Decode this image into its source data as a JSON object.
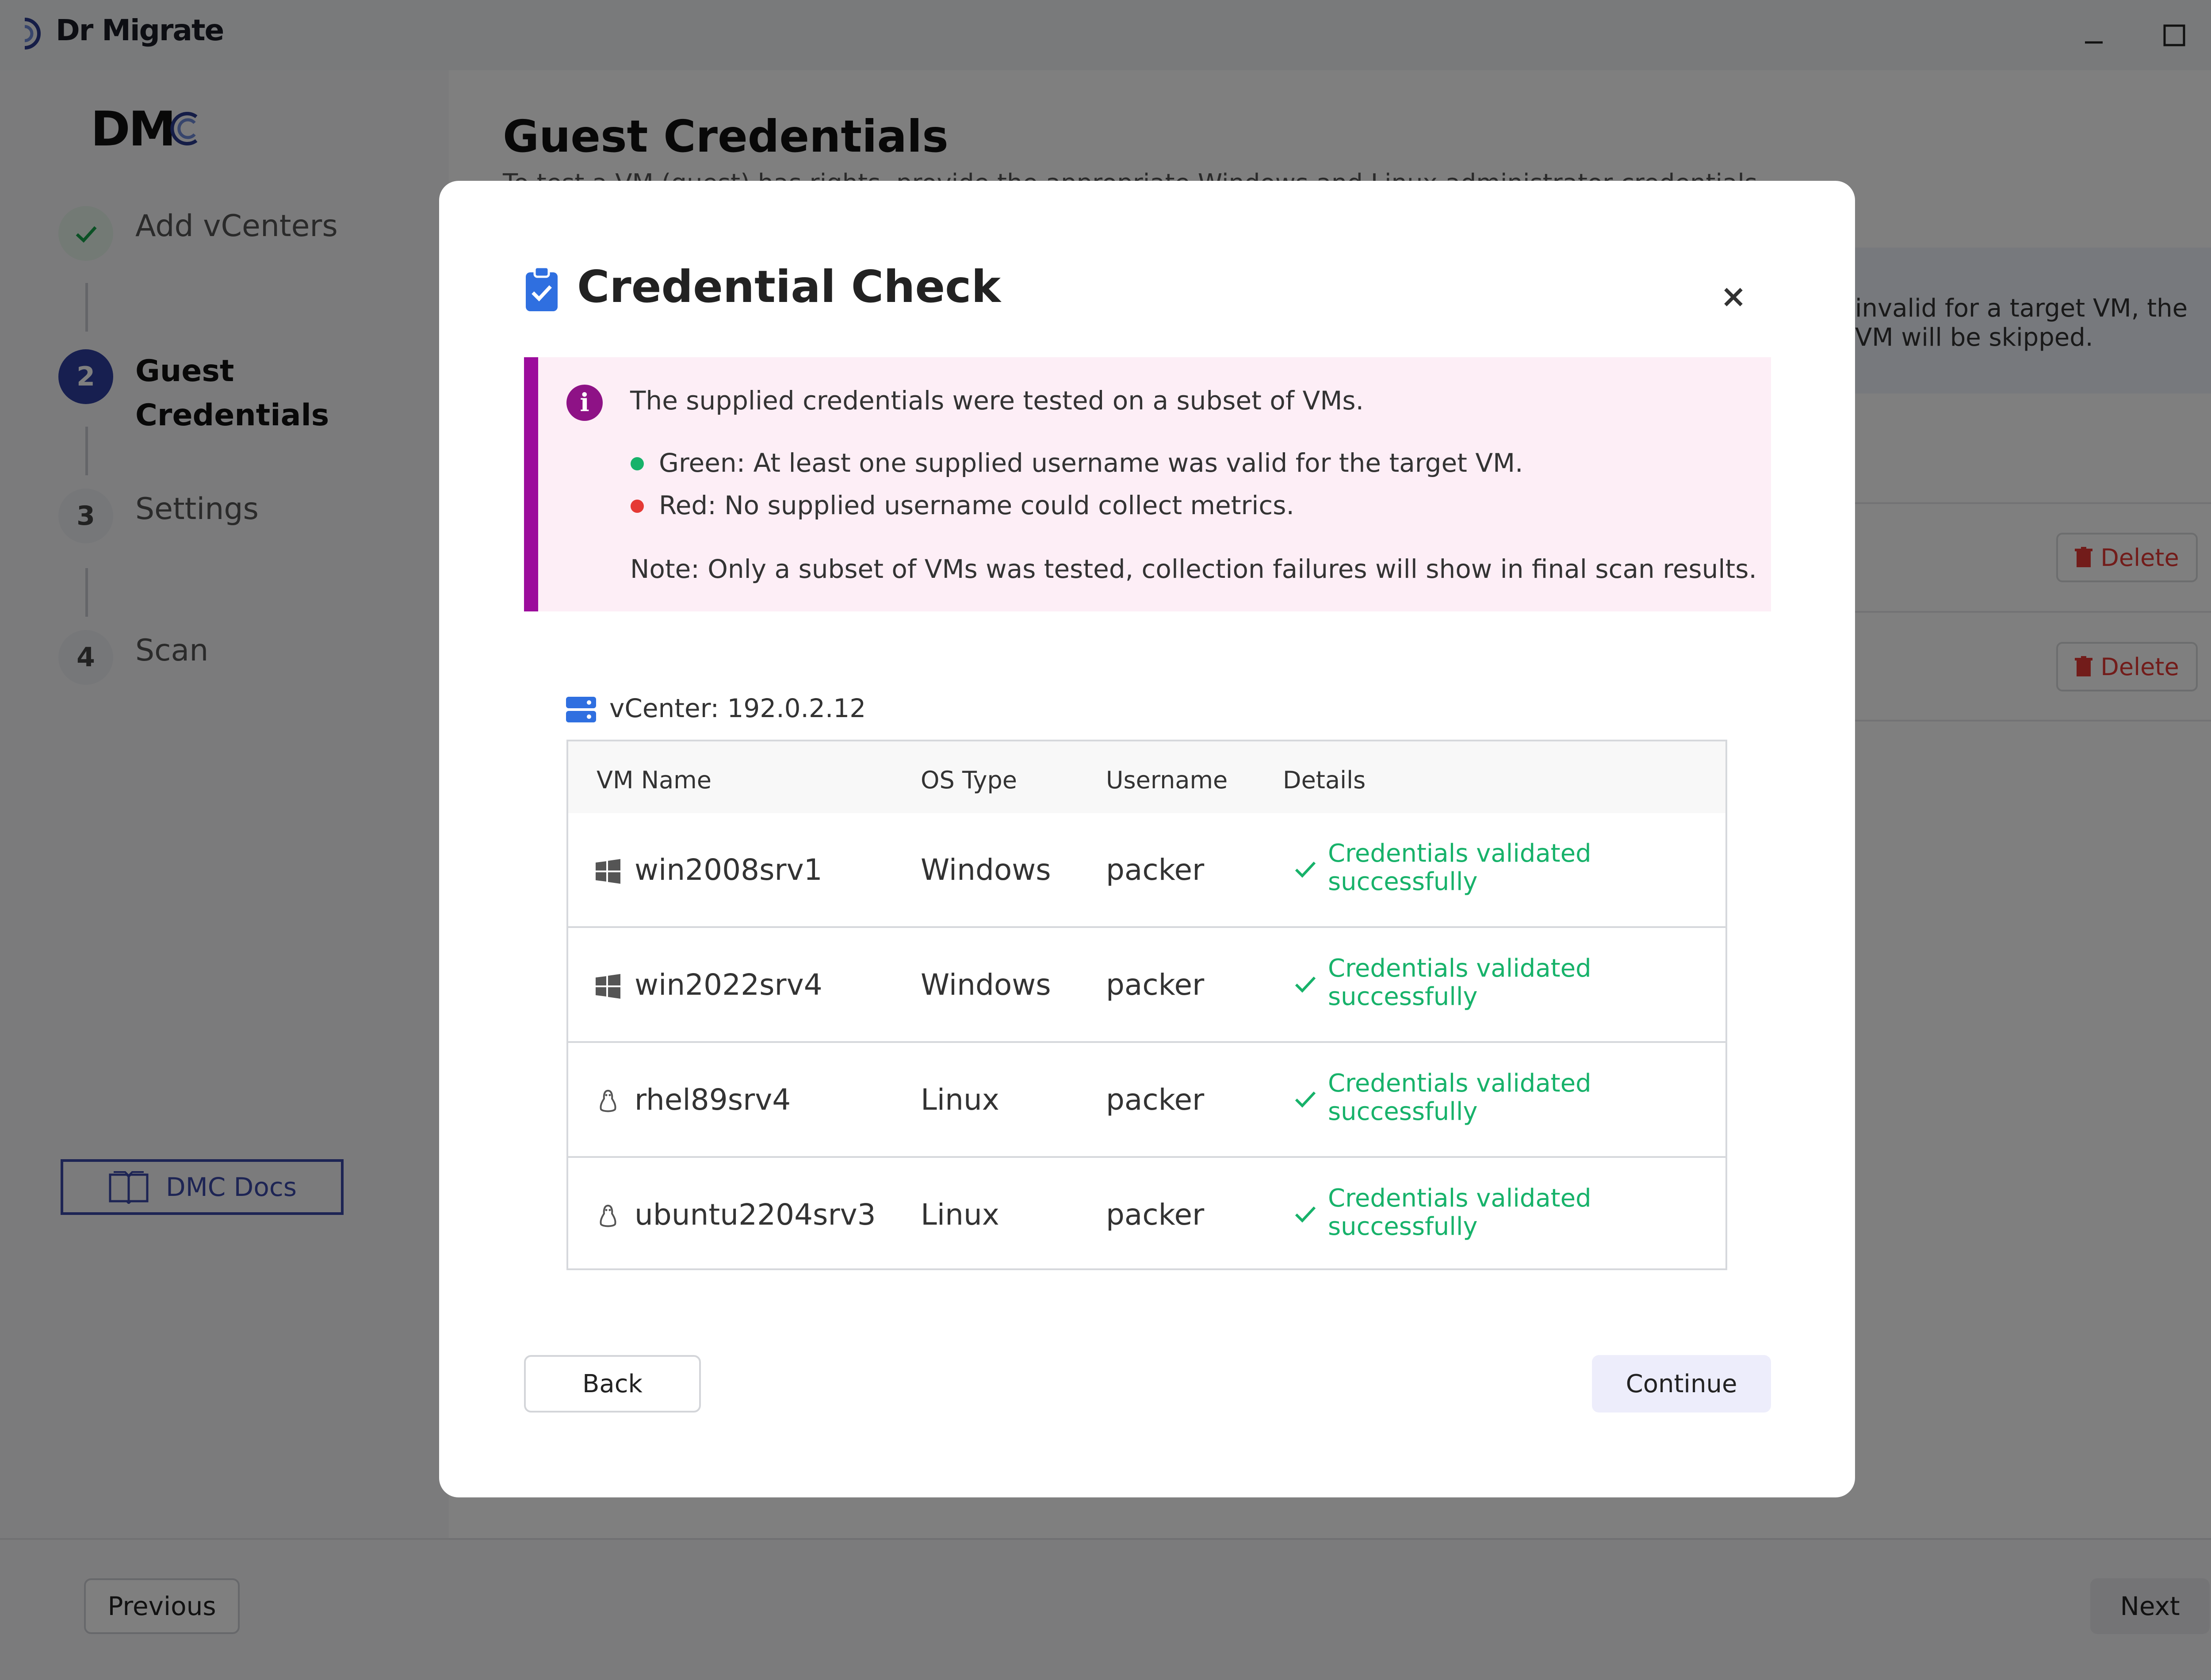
{
  "window": {
    "title": "Dr Migrate"
  },
  "sidebar": {
    "logo_text": "DM",
    "steps": [
      {
        "number": "✓",
        "label": "Add vCenters",
        "status": "completed"
      },
      {
        "number": "2",
        "label": "Guest",
        "label2": "Credentials",
        "status": "active"
      },
      {
        "number": "3",
        "label": "Settings",
        "status": "pending"
      },
      {
        "number": "4",
        "label": "Scan",
        "status": "pending"
      }
    ],
    "docs_label": "DMC Docs"
  },
  "page": {
    "title": "Guest Credentials",
    "subtitle": "To test a VM (guest) has rights, provide the appropriate Windows and Linux administrator credentials.",
    "info_line1": "invalid for a target VM, the",
    "info_line2": "VM will be skipped.",
    "delete_label": "Delete"
  },
  "footer": {
    "previous_label": "Previous",
    "next_label": "Next"
  },
  "modal": {
    "title": "Credential Check",
    "close_glyph": "×",
    "alert": {
      "icon_glyph": "i",
      "line1": "The supplied credentials were tested on a subset of VMs.",
      "green": "Green: At least one supplied username was valid for the target VM.",
      "red": "Red: No supplied username could collect metrics.",
      "note": "Note: Only a subset of VMs was tested, collection failures will show in final scan results."
    },
    "vcenter_label": "vCenter: 192.0.2.12",
    "columns": [
      "VM Name",
      "OS Type",
      "Username",
      "Details"
    ],
    "rows": [
      {
        "vm": "win2008srv1",
        "os": "Windows",
        "user": "packer",
        "detail1": "Credentials validated",
        "detail2": "successfully"
      },
      {
        "vm": "win2022srv4",
        "os": "Windows",
        "user": "packer",
        "detail1": "Credentials validated",
        "detail2": "successfully"
      },
      {
        "vm": "rhel89srv4",
        "os": "Linux",
        "user": "packer",
        "detail1": "Credentials validated",
        "detail2": "successfully"
      },
      {
        "vm": "ubuntu2204srv3",
        "os": "Linux",
        "user": "packer",
        "detail1": "Credentials validated",
        "detail2": "successfully"
      }
    ],
    "back_label": "Back",
    "continue_label": "Continue"
  },
  "colors": {
    "accent": "#3a48a8",
    "success": "#17b26a",
    "danger": "#e53935",
    "alert_border": "#9c0c9c",
    "alert_bg": "#fdeef6"
  }
}
